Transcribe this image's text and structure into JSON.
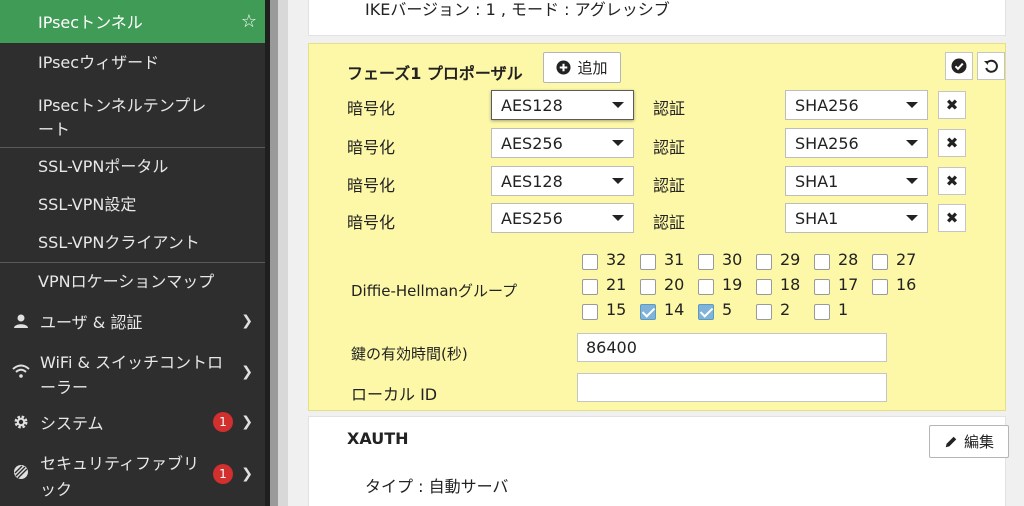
{
  "sidebar": {
    "items": [
      {
        "label": "IPsecトンネル"
      },
      {
        "label": "IPsecウィザード"
      },
      {
        "label": "IPsecトンネルテンプレ"
      },
      {
        "label": "ート"
      },
      {
        "label": "SSL-VPNポータル"
      },
      {
        "label": "SSL-VPN設定"
      },
      {
        "label": "SSL-VPNクライアント"
      },
      {
        "label": "VPNロケーションマップ"
      }
    ],
    "sections": [
      {
        "label": "ユーザ & 認証",
        "icon": "user-icon"
      },
      {
        "label1": "WiFi & スイッチコントロ",
        "label2": "ーラー",
        "icon": "wifi-icon"
      },
      {
        "label": "システム",
        "icon": "gear-icon",
        "badge": "1"
      },
      {
        "label1": "セキュリティファブリ",
        "label2": "ック",
        "icon": "fabric-icon",
        "badge": "1"
      }
    ],
    "favorite_icon": "☆",
    "colors": {
      "bg": "#2e2e2e",
      "active": "#3f9b55",
      "badge": "#d22f2f"
    }
  },
  "top_card": {
    "summary": "IKEバージョン : 1 , モード : アグレッシブ"
  },
  "phase1": {
    "title": "フェーズ1 プロポーザル",
    "add_label": "追加",
    "proposals": [
      {
        "enc_label": "暗号化",
        "enc": "AES128",
        "auth_label": "認証",
        "auth": "SHA256"
      },
      {
        "enc_label": "暗号化",
        "enc": "AES256",
        "auth_label": "認証",
        "auth": "SHA256"
      },
      {
        "enc_label": "暗号化",
        "enc": "AES128",
        "auth_label": "認証",
        "auth": "SHA1"
      },
      {
        "enc_label": "暗号化",
        "enc": "AES256",
        "auth_label": "認証",
        "auth": "SHA1"
      }
    ],
    "dh_label": "Diffie-Hellmanグループ",
    "dh_groups": [
      {
        "n": "32",
        "checked": false
      },
      {
        "n": "31",
        "checked": false
      },
      {
        "n": "30",
        "checked": false
      },
      {
        "n": "29",
        "checked": false
      },
      {
        "n": "28",
        "checked": false
      },
      {
        "n": "27",
        "checked": false
      },
      {
        "n": "21",
        "checked": false
      },
      {
        "n": "20",
        "checked": false
      },
      {
        "n": "19",
        "checked": false
      },
      {
        "n": "18",
        "checked": false
      },
      {
        "n": "17",
        "checked": false
      },
      {
        "n": "16",
        "checked": false
      },
      {
        "n": "15",
        "checked": false
      },
      {
        "n": "14",
        "checked": true
      },
      {
        "n": "5",
        "checked": true
      },
      {
        "n": "2",
        "checked": false
      },
      {
        "n": "1",
        "checked": false
      }
    ],
    "keylife_label": "鍵の有効時間(秒)",
    "keylife_value": "86400",
    "localid_label": "ローカル ID",
    "localid_value": "",
    "bg": "#fdf8a8"
  },
  "xauth": {
    "title": "XAUTH",
    "edit_label": "編集",
    "type_text": "タイプ : 自動サーバ"
  }
}
